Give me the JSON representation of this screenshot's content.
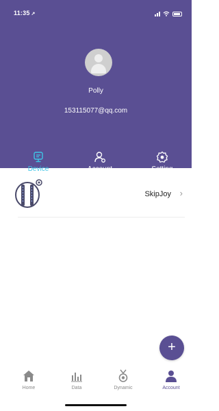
{
  "status_bar": {
    "time": "11:35",
    "location_arrow": "↗"
  },
  "profile": {
    "name": "Polly",
    "email": "153115077@qq.com"
  },
  "tabs": [
    {
      "label": "Device",
      "icon": "device-icon",
      "active": true
    },
    {
      "label_line1": "Account",
      "label_line2": "management",
      "icon": "account-management-icon"
    },
    {
      "label": "Setting",
      "icon": "gear-icon"
    }
  ],
  "device": {
    "name": "SkipJoy",
    "chevron": "›"
  },
  "fab": {
    "label": "+"
  },
  "bottom_nav": [
    {
      "label": "Home",
      "icon": "home-icon"
    },
    {
      "label": "Data",
      "icon": "bar-chart-icon"
    },
    {
      "label": "Dynamic",
      "icon": "medal-icon"
    },
    {
      "label": "Account",
      "icon": "person-icon",
      "active": true
    }
  ],
  "colors": {
    "primary": "#5a4f93",
    "active_tab": "#3ec5e6",
    "nav_inactive": "#888888"
  }
}
